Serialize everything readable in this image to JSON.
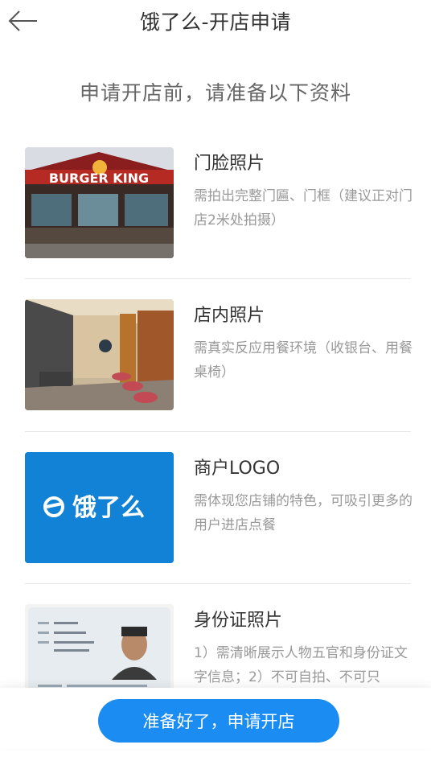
{
  "header": {
    "title": "饿了么-开店申请"
  },
  "intro": {
    "subtitle": "申请开店前，请准备以下资料"
  },
  "items": [
    {
      "title": "门脸照片",
      "desc": "需拍出完整门匾、门框（建议正对门店2米处拍摄）",
      "thumb_text": "BURGER KING"
    },
    {
      "title": "店内照片",
      "desc": "需真实反应用餐环境（收银台、用餐桌椅）"
    },
    {
      "title": "商户LOGO",
      "desc": "需体现您店铺的特色，可吸引更多的用户进店点餐",
      "thumb_text": "饿了么"
    },
    {
      "title": "身份证照片",
      "desc": "1）需清晰展示人物五官和身份证文字信息；2）不可自拍、不可只"
    }
  ],
  "footer": {
    "apply_label": "准备好了，申请开店"
  },
  "colors": {
    "accent": "#1a8cf2",
    "logo_bg": "#1282d6"
  }
}
